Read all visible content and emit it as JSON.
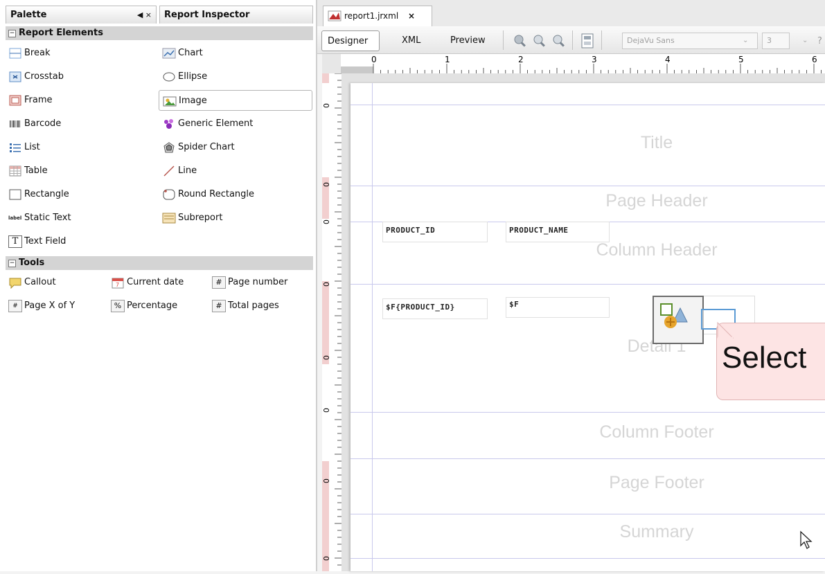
{
  "palette": {
    "tab_label": "Palette",
    "tab_controls": "◀ ×",
    "inspector_tab_label": "Report Inspector",
    "report_elements_title": "Report Elements",
    "tools_title": "Tools",
    "report_elements": [
      {
        "label": "Break",
        "icon": "break-icon"
      },
      {
        "label": "Chart",
        "icon": "chart-icon"
      },
      {
        "label": "Crosstab",
        "icon": "crosstab-icon"
      },
      {
        "label": "Ellipse",
        "icon": "ellipse-icon"
      },
      {
        "label": "Frame",
        "icon": "frame-icon"
      },
      {
        "label": "Image",
        "icon": "image-icon"
      },
      {
        "label": "Barcode",
        "icon": "barcode-icon"
      },
      {
        "label": "Generic Element",
        "icon": "generic-element-icon"
      },
      {
        "label": "List",
        "icon": "list-icon"
      },
      {
        "label": "Spider Chart",
        "icon": "spider-chart-icon"
      },
      {
        "label": "Table",
        "icon": "table-icon"
      },
      {
        "label": "Line",
        "icon": "line-icon"
      },
      {
        "label": "Rectangle",
        "icon": "rectangle-icon"
      },
      {
        "label": "Round Rectangle",
        "icon": "round-rectangle-icon"
      },
      {
        "label": "Static Text",
        "icon": "static-text-icon"
      },
      {
        "label": "Subreport",
        "icon": "subreport-icon"
      },
      {
        "label": "Text Field",
        "icon": "text-field-icon"
      }
    ],
    "static_text_icon_text": "label",
    "text_field_icon_text": "T",
    "tools": [
      {
        "label": "Callout",
        "icon": "callout-icon"
      },
      {
        "label": "Current date",
        "icon": "current-date-icon"
      },
      {
        "label": "Page number",
        "icon": "page-number-icon"
      },
      {
        "label": "Page X of Y",
        "icon": "page-x-of-y-icon"
      },
      {
        "label": "Percentage",
        "icon": "percentage-icon"
      },
      {
        "label": "Total pages",
        "icon": "total-pages-icon"
      }
    ],
    "tool_glyphs": {
      "page_number": "#",
      "total_pages": "#",
      "percentage": "%",
      "page_x_of_y": "#"
    }
  },
  "editor": {
    "doc_tab_label": "report1.jrxml",
    "doc_tab_close": "×",
    "tabs": {
      "designer": "Designer",
      "xml": "XML",
      "preview": "Preview"
    },
    "font_name": "DejaVu Sans",
    "font_size": "3",
    "ruler_numbers": [
      "0",
      "1",
      "2",
      "3",
      "4",
      "5",
      "6"
    ],
    "vruler_numbers": [
      "0",
      "0",
      "0",
      "0",
      "0",
      "0",
      "0",
      "0"
    ]
  },
  "report": {
    "bands": [
      "Title",
      "Page Header",
      "Column Header",
      "Detail 1",
      "Column Footer",
      "Page Footer",
      "Summary"
    ],
    "fields": {
      "product_id_header": "PRODUCT_ID",
      "product_name_header": "PRODUCT_NAME",
      "product_id_value": "$F{PRODUCT_ID}",
      "product_name_value": "$F"
    },
    "callout_text": "Select"
  }
}
